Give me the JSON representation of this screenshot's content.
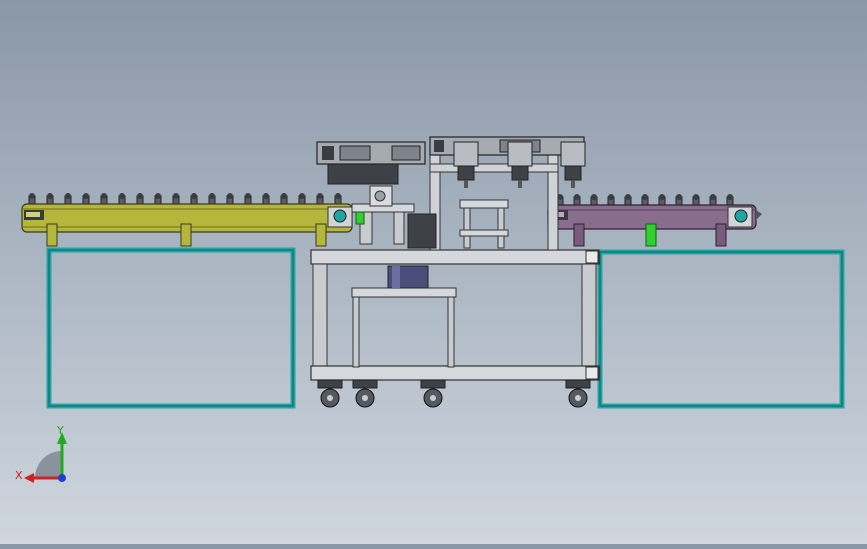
{
  "view": {
    "type": "cad-3d-viewport",
    "background_top": "#8a97a7",
    "background_bottom": "#cfd6de"
  },
  "model": {
    "parts": [
      {
        "name": "left-roller-conveyor",
        "color": "#b5b63c"
      },
      {
        "name": "right-roller-conveyor",
        "color": "#8a6d8e"
      },
      {
        "name": "center-machine-frame",
        "color": "#b8bcc4"
      },
      {
        "name": "left-base-frame",
        "color": "#1fa6a4"
      },
      {
        "name": "right-base-frame",
        "color": "#1fa6a4"
      },
      {
        "name": "gantry-pick-heads",
        "color": "#9da2a8"
      },
      {
        "name": "caster-wheels",
        "color": "#555a60"
      }
    ],
    "accent_green": "#2fd12f",
    "accent_teal": "#1fa6a4"
  },
  "triad": {
    "x_label": "X",
    "y_label": "Y",
    "x_color": "#d42020",
    "y_color": "#1faa1f",
    "z_color": "#1e3fd0"
  }
}
